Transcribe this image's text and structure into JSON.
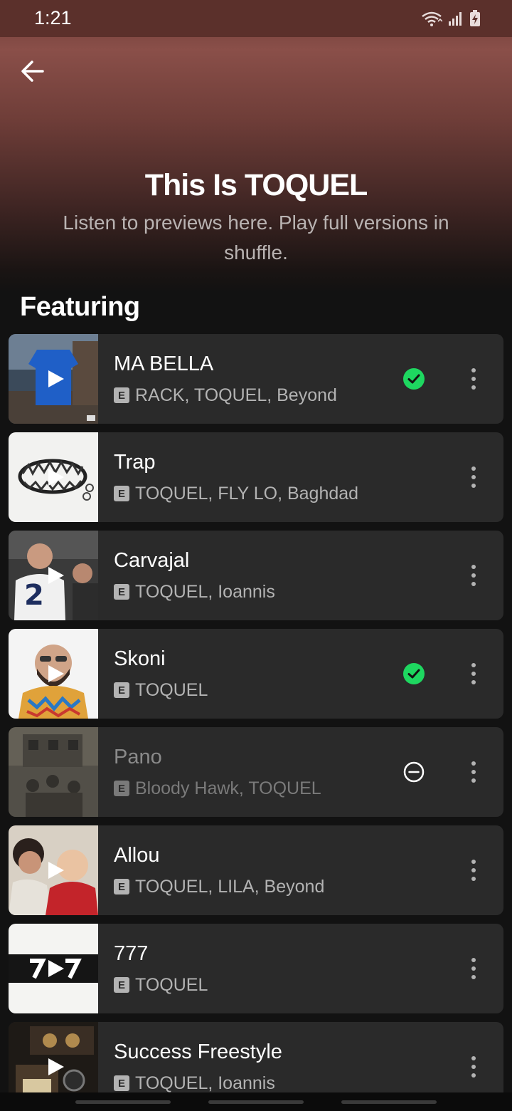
{
  "status_bar": {
    "time": "1:21"
  },
  "header": {
    "title": "This Is TOQUEL",
    "subtitle": "Listen to previews here. Play full versions in shuffle.",
    "back_icon": "arrow-left-icon"
  },
  "section": {
    "title": "Featuring"
  },
  "explicit_label": "E",
  "colors": {
    "header_gradient_top": "#8a4f49",
    "background": "#121212",
    "card": "#2a2a2a",
    "saved_green": "#1ed760",
    "secondary_text": "#b3b3b3"
  },
  "tracks": [
    {
      "title": "MA BELLA",
      "artists": "RACK, TOQUEL, Beyond",
      "explicit": true,
      "status": "saved",
      "status_icon": "check-circle-icon"
    },
    {
      "title": "Trap",
      "artists": "TOQUEL, FLY LO, Baghdad",
      "explicit": true,
      "status": "none"
    },
    {
      "title": "Carvajal",
      "artists": "TOQUEL, Ioannis",
      "explicit": true,
      "status": "none"
    },
    {
      "title": "Skoni",
      "artists": "TOQUEL",
      "explicit": true,
      "status": "saved",
      "status_icon": "check-circle-icon"
    },
    {
      "title": "Pano",
      "artists": "Bloody Hawk, TOQUEL",
      "explicit": true,
      "status": "hidden",
      "status_icon": "minus-circle-icon"
    },
    {
      "title": "Allou",
      "artists": "TOQUEL, LILA, Beyond",
      "explicit": true,
      "status": "none"
    },
    {
      "title": "777",
      "artists": "TOQUEL",
      "explicit": true,
      "status": "none"
    },
    {
      "title": "Success Freestyle",
      "artists": "TOQUEL, Ioannis",
      "explicit": true,
      "status": "none"
    }
  ]
}
